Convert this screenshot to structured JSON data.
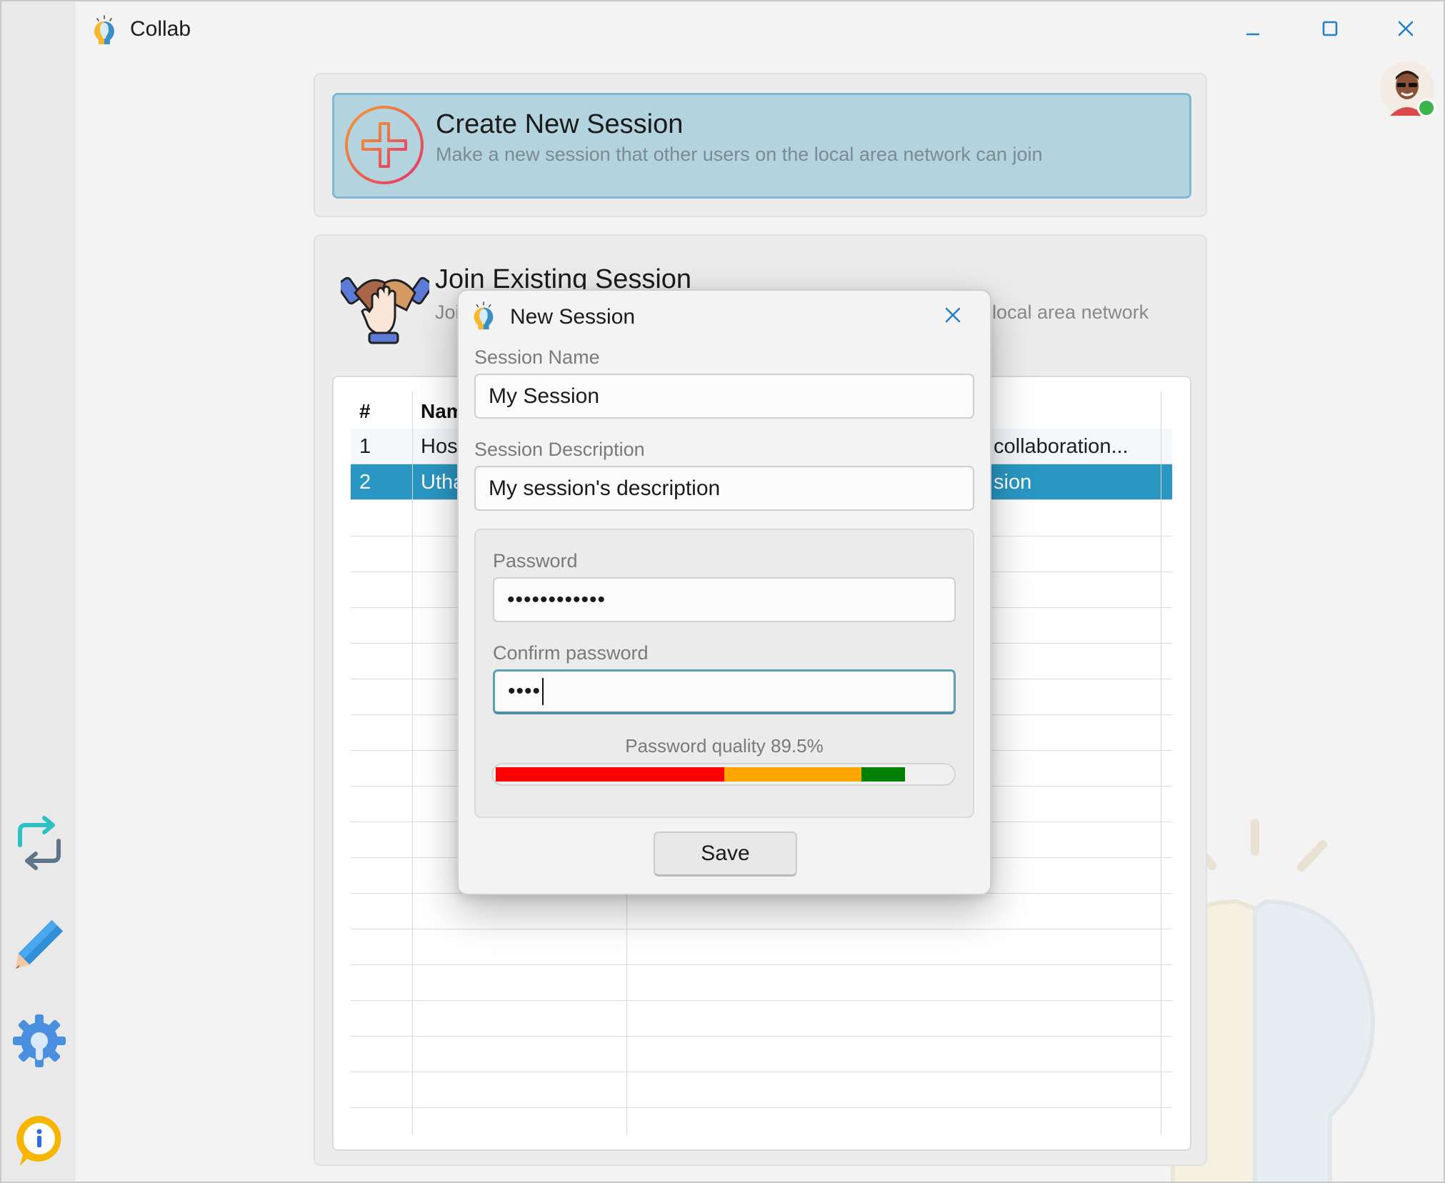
{
  "window": {
    "title": "Collab",
    "icons": {
      "minimize": "minimize-icon",
      "maximize": "maximize-icon",
      "close": "close-icon"
    }
  },
  "user": {
    "status": "online",
    "status_color": "#3bb54a"
  },
  "sidebar": {
    "items": [
      {
        "icon": "sync-arrows-icon"
      },
      {
        "icon": "pencil-icon"
      },
      {
        "icon": "settings-gear-icon"
      },
      {
        "icon": "info-icon"
      }
    ]
  },
  "create_session": {
    "title": "Create New Session",
    "subtitle": "Make a new session that other users on the local area network can join",
    "icon": "plus-circle-icon"
  },
  "join_session": {
    "title": "Join Existing Session",
    "subtitle_left": "Joi",
    "subtitle_right": "local area network",
    "icon": "handshake-icon",
    "table": {
      "headers": [
        "#",
        "Nam"
      ],
      "rows": [
        {
          "num": "1",
          "name": "Hos",
          "desc": "collaboration...",
          "selected": false
        },
        {
          "num": "2",
          "name": "Utha",
          "desc": "sion",
          "selected": true
        }
      ]
    }
  },
  "dialog": {
    "title": "New Session",
    "session_name_label": "Session Name",
    "session_name_value": "My Session",
    "session_description_label": "Session Description",
    "session_description_value": "My session's description",
    "password_label": "Password",
    "password_value": "••••••••••••",
    "confirm_password_label": "Confirm password",
    "confirm_password_value": "••••",
    "quality_label": "Password quality 89.5%",
    "quality_percent": 89.5,
    "quality_colors": {
      "weak": "#ff0000",
      "medium": "#ffa500",
      "strong": "#008000"
    },
    "save_label": "Save"
  },
  "colors": {
    "accent": "#2a97c3",
    "create_card_bg": "#b3d3df",
    "create_card_border": "#7fb8d2"
  }
}
